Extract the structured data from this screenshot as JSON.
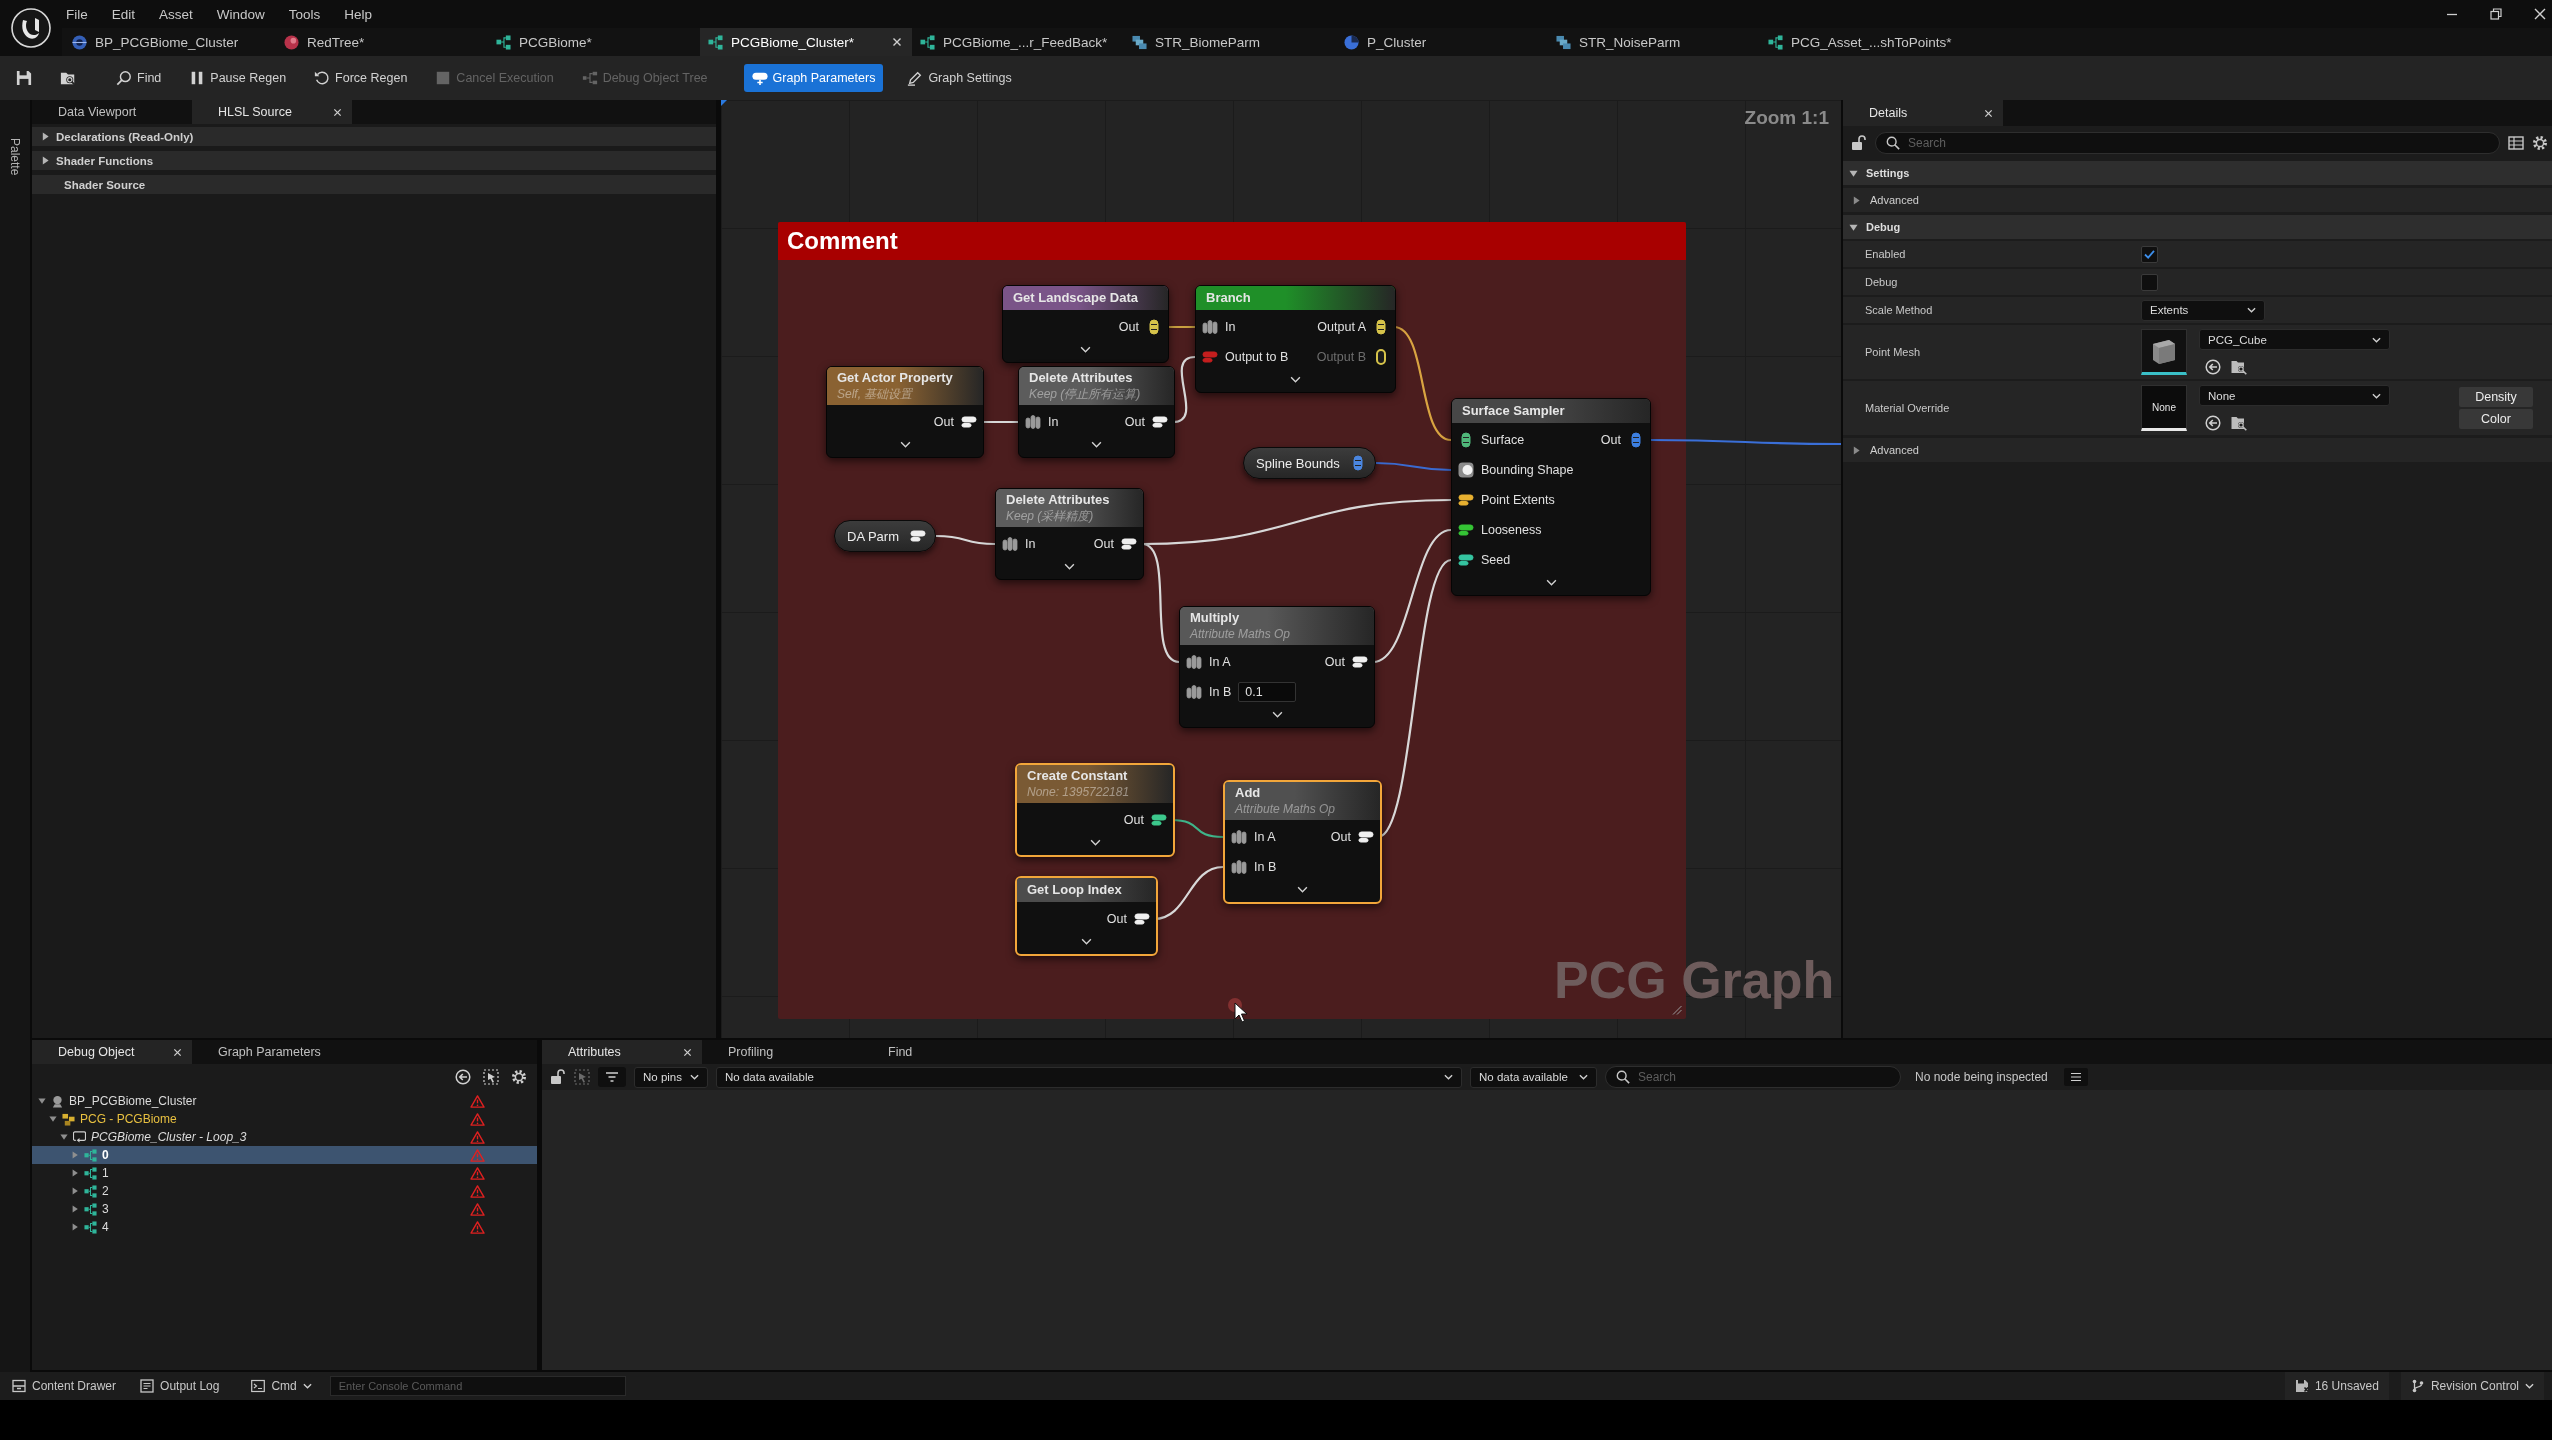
{
  "menu_bar": {
    "items": [
      "File",
      "Edit",
      "Asset",
      "Window",
      "Tools",
      "Help"
    ]
  },
  "document_tabs": [
    {
      "label": "BP_PCGBiome_Cluster",
      "kind": "blueprint",
      "selected": false
    },
    {
      "label": "RedTree*",
      "kind": "sphere",
      "selected": false
    },
    {
      "label": "PCGBiome*",
      "kind": "graph",
      "selected": false
    },
    {
      "label": "PCGBiome_Cluster*",
      "kind": "graph",
      "selected": true
    },
    {
      "label": "PCGBiome_...r_FeedBack*",
      "kind": "graph",
      "selected": false
    },
    {
      "label": "STR_BiomeParm",
      "kind": "struct",
      "selected": false
    },
    {
      "label": "P_Cluster",
      "kind": "pie",
      "selected": false
    },
    {
      "label": "STR_NoiseParm",
      "kind": "struct",
      "selected": false
    },
    {
      "label": "PCG_Asset_...shToPoints*",
      "kind": "graph",
      "selected": false
    }
  ],
  "toolbar": [
    {
      "kind": "save",
      "selected": false,
      "disabled": false
    },
    {
      "kind": "browse",
      "selected": false,
      "disabled": false
    },
    {
      "kind": "find",
      "label": "Find",
      "selected": false,
      "disabled": false
    },
    {
      "kind": "pause",
      "label": "Pause Regen",
      "selected": false,
      "disabled": false
    },
    {
      "kind": "regen",
      "label": "Force Regen",
      "selected": false,
      "disabled": false
    },
    {
      "kind": "cancel",
      "label": "Cancel Execution",
      "selected": false,
      "disabled": true
    },
    {
      "kind": "tree",
      "label": "Debug Object Tree",
      "selected": false,
      "disabled": true
    },
    {
      "kind": "params",
      "label": "Graph Parameters",
      "selected": true,
      "disabled": false
    },
    {
      "kind": "settings",
      "label": "Graph Settings",
      "selected": false,
      "disabled": false
    }
  ],
  "palette": {
    "label": "Palette"
  },
  "left_panel": {
    "tabs": [
      {
        "label": "Data Viewport",
        "selected": false
      },
      {
        "label": "HLSL Source",
        "selected": true
      }
    ],
    "sections": [
      {
        "label": "Declarations (Read-Only)",
        "kind": "collapsible",
        "expanded": false
      },
      {
        "label": "Shader Functions",
        "kind": "collapsible",
        "expanded": false
      },
      {
        "label": "Shader Source",
        "kind": "plain"
      }
    ]
  },
  "graph": {
    "zoom_label": "Zoom 1:1",
    "comment": {
      "title": "Comment"
    },
    "nodes": [
      {
        "kind": "node",
        "title": "Get Landscape Data",
        "color": "#7a5488",
        "selected": false,
        "rows": [
          {
            "output": {
              "label": "Out",
              "kind": "stack",
              "color": "#d6c34a",
              "disabled": false
            }
          }
        ]
      },
      {
        "kind": "node",
        "title": "Branch",
        "color": "#1f8f28",
        "selected": false,
        "rows": [
          {
            "input": {
              "label": "In",
              "kind": "points",
              "color": "#9a9a9a",
              "disabled": false
            },
            "output": {
              "label": "Output A",
              "kind": "stack",
              "color": "#d6c34a",
              "disabled": false
            }
          },
          {
            "input": {
              "label": "Output to B",
              "kind": "bar",
              "color": "#c41e1e",
              "disabled": false
            },
            "output": {
              "label": "Output B",
              "kind": "stack",
              "color": "#d6c34a",
              "disabled": true
            }
          }
        ]
      },
      {
        "kind": "node",
        "title": "Get Actor Property",
        "subtitle": "Self, 基础设置",
        "color": "#8a6232",
        "selected": false,
        "rows": [
          {
            "output": {
              "label": "Out",
              "kind": "bar",
              "color": "#f0f0f0",
              "disabled": false
            }
          }
        ]
      },
      {
        "kind": "node",
        "title": "Delete Attributes",
        "subtitle": "Keep (停止所有运算)",
        "color": "#5c5c5c",
        "selected": false,
        "rows": [
          {
            "input": {
              "label": "In",
              "kind": "points",
              "color": "#9a9a9a",
              "disabled": false
            },
            "output": {
              "label": "Out",
              "kind": "bar",
              "color": "#f0f0f0",
              "disabled": false
            }
          }
        ]
      },
      {
        "kind": "pill",
        "title": "Spline Bounds",
        "selected": false,
        "pin": {
          "kind": "stack",
          "color": "#4a86e0",
          "disabled": false
        }
      },
      {
        "kind": "node",
        "title": "Surface Sampler",
        "color": "#474747",
        "selected": false,
        "rows": [
          {
            "input": {
              "label": "Surface",
              "kind": "stack",
              "color": "#4fb87a",
              "disabled": false
            },
            "output": {
              "label": "Out",
              "kind": "stack",
              "color": "#3d7fe0",
              "disabled": false
            }
          },
          {
            "input": {
              "label": "Bounding Shape",
              "kind": "circle",
              "color": "#f2f2f2",
              "disabled": false
            }
          },
          {
            "input": {
              "label": "Point Extents",
              "kind": "bar",
              "color": "#e8b030",
              "disabled": false
            }
          },
          {
            "input": {
              "label": "Looseness",
              "kind": "bar",
              "color": "#35c435",
              "disabled": false
            }
          },
          {
            "input": {
              "label": "Seed",
              "kind": "bar",
              "color": "#35c4a0",
              "disabled": false
            }
          }
        ]
      },
      {
        "kind": "pill",
        "title": "DA Parm",
        "selected": false,
        "pin": {
          "kind": "bar",
          "color": "#f0f0f0",
          "disabled": false
        }
      },
      {
        "kind": "node",
        "title": "Delete Attributes",
        "subtitle": "Keep (采样精度)",
        "color": "#5c5c5c",
        "selected": false,
        "rows": [
          {
            "input": {
              "label": "In",
              "kind": "points",
              "color": "#9a9a9a",
              "disabled": false
            },
            "output": {
              "label": "Out",
              "kind": "bar",
              "color": "#f0f0f0",
              "disabled": false
            }
          }
        ]
      },
      {
        "kind": "node",
        "title": "Multiply",
        "subtitle": "Attribute Maths Op",
        "color": "#585858",
        "selected": false,
        "rows": [
          {
            "input": {
              "label": "In A",
              "kind": "points",
              "color": "#9a9a9a",
              "disabled": false
            },
            "output": {
              "label": "Out",
              "kind": "bar",
              "color": "#f0f0f0",
              "disabled": false
            }
          },
          {
            "input": {
              "label": "In B",
              "kind": "points",
              "color": "#9a9a9a",
              "disabled": false,
              "value": "0.1"
            }
          }
        ]
      },
      {
        "kind": "node",
        "title": "Create Constant",
        "subtitle": "None: 1395722181",
        "color": "#7a5a34",
        "selected": true,
        "rows": [
          {
            "output": {
              "label": "Out",
              "kind": "bar",
              "color": "#3cc88c",
              "disabled": false
            }
          }
        ]
      },
      {
        "kind": "node",
        "title": "Get Loop Index",
        "color": "#4c4c4c",
        "selected": true,
        "rows": [
          {
            "output": {
              "label": "Out",
              "kind": "bar",
              "color": "#f0f0f0",
              "disabled": false
            }
          }
        ]
      },
      {
        "kind": "node",
        "title": "Add",
        "subtitle": "Attribute Maths Op",
        "color": "#505050",
        "selected": true,
        "rows": [
          {
            "input": {
              "label": "In A",
              "kind": "points",
              "color": "#9a9a9a",
              "disabled": false
            },
            "output": {
              "label": "Out",
              "kind": "bar",
              "color": "#f0f0f0",
              "disabled": false
            }
          },
          {
            "input": {
              "label": "In B",
              "kind": "points",
              "color": "#9a9a9a",
              "disabled": false
            }
          }
        ]
      }
    ],
    "watermark": "PCG Graph"
  },
  "details": {
    "tab": {
      "label": "Details"
    },
    "search": {
      "placeholder": "Search"
    },
    "sections": [
      {
        "label": "Settings",
        "expanded": true,
        "rows": [
          {
            "kind": "group",
            "label": "Advanced",
            "expanded": false
          }
        ]
      },
      {
        "label": "Debug",
        "expanded": true,
        "rows": [
          {
            "kind": "checkbox",
            "label": "Enabled",
            "checked": true
          },
          {
            "kind": "checkbox",
            "label": "Debug",
            "checked": false
          },
          {
            "kind": "dropdown",
            "label": "Scale Method",
            "value": "Extents"
          },
          {
            "kind": "asset",
            "label": "Point Mesh",
            "value": "PCG_Cube",
            "preview": {
              "kind": "mesh"
            }
          },
          {
            "kind": "asset",
            "label": "Material Override",
            "value": "None",
            "preview": {
              "kind": "text",
              "label": "None"
            },
            "buttons": [
              "Density",
              "Color"
            ]
          },
          {
            "kind": "group",
            "label": "Advanced",
            "expanded": false
          }
        ]
      }
    ]
  },
  "debug_panel": {
    "tabs": [
      {
        "label": "Debug Object",
        "selected": true
      },
      {
        "label": "Graph Parameters",
        "selected": false
      }
    ],
    "tree": [
      {
        "label": "BP_PCGBiome_Cluster",
        "kind": "actor",
        "expanded": true,
        "selected": false,
        "warning": true,
        "children": [
          {
            "label": "PCG - PCGBiome",
            "kind": "component",
            "expanded": true,
            "selected": false,
            "warning": true,
            "children": [
              {
                "label": "PCGBiome_Cluster - Loop_3",
                "kind": "loop",
                "expanded": true,
                "selected": false,
                "warning": true,
                "children": [
                  {
                    "label": "0",
                    "kind": "graph",
                    "expanded": false,
                    "selected": true,
                    "warning": true
                  },
                  {
                    "label": "1",
                    "kind": "graph",
                    "expanded": false,
                    "selected": false,
                    "warning": true
                  },
                  {
                    "label": "2",
                    "kind": "graph",
                    "expanded": false,
                    "selected": false,
                    "warning": true
                  },
                  {
                    "label": "3",
                    "kind": "graph",
                    "expanded": false,
                    "selected": false,
                    "warning": true
                  },
                  {
                    "label": "4",
                    "kind": "graph",
                    "expanded": false,
                    "selected": false,
                    "warning": true
                  }
                ]
              }
            ]
          }
        ]
      }
    ]
  },
  "attributes_panel": {
    "tabs": [
      {
        "label": "Attributes",
        "selected": true
      },
      {
        "label": "Profiling",
        "selected": false
      },
      {
        "label": "Find",
        "selected": false
      }
    ],
    "pin_filter": "No pins",
    "data_select": "No data available",
    "data_select_2": "No data available",
    "search": {
      "placeholder": "Search"
    },
    "status": "No node being inspected"
  },
  "status_bar": {
    "left": [
      {
        "label": "Content Drawer",
        "kind": "drawer"
      },
      {
        "label": "Output Log",
        "kind": "log"
      }
    ],
    "command": "Cmd",
    "console": {
      "placeholder": "Enter Console Command"
    },
    "right": [
      {
        "label": "16 Unsaved",
        "kind": "unsaved"
      },
      {
        "label": "Revision Control",
        "kind": "revision"
      }
    ]
  }
}
